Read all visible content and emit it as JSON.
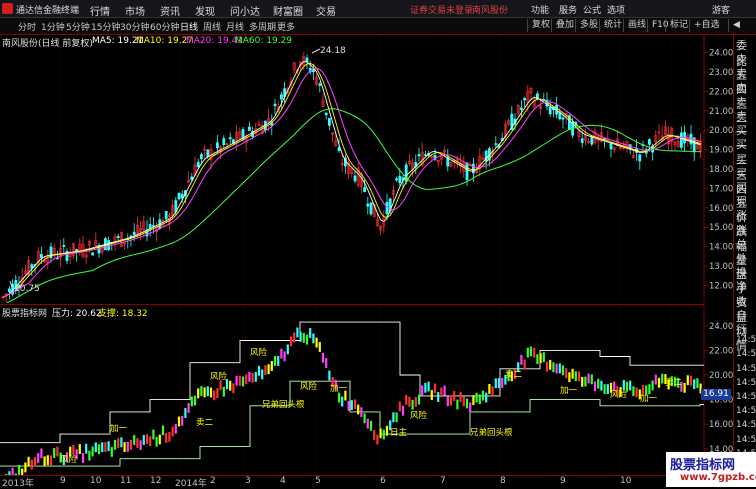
{
  "titlebar": {
    "app_name": "通达信金融终端",
    "menus": [
      "行情",
      "市场",
      "资讯",
      "发现",
      "问小达",
      "财富圈",
      "交易"
    ],
    "notice": "证券交易未登录",
    "stock_name": "南风股份",
    "right_menus": [
      "功能",
      "服务",
      "公式",
      "选项"
    ],
    "guest": "游客"
  },
  "periodbar": {
    "periods": [
      "分时",
      "1分钟",
      "5分钟",
      "15分钟",
      "30分钟",
      "60分钟",
      "日线",
      "周线",
      "月线",
      "多周期",
      "更多"
    ],
    "active_period": "日线",
    "tools": [
      "复权",
      "叠加",
      "多股",
      "统计",
      "画线",
      "F10",
      "标记",
      "+自选",
      "◀"
    ]
  },
  "main": {
    "title": "南风股份(日线 前复权)",
    "ma_legend": [
      {
        "label": "MA5: 19.21",
        "color": "#ffffff"
      },
      {
        "label": "MA10: 19.27",
        "color": "#ffff00"
      },
      {
        "label": "MA20: 19.41",
        "color": "#ff40ff"
      },
      {
        "label": "MA60: 19.29",
        "color": "#40ff40"
      }
    ],
    "high_label": "24.18",
    "low_label": "10.75",
    "axis_ticks": [
      "24.00",
      "23.00",
      "22.00",
      "21.00",
      "20.00",
      "19.00",
      "18.00",
      "17.00",
      "16.00",
      "15.00",
      "14.00",
      "13.00",
      "12.00"
    ]
  },
  "sub": {
    "title": "股票指标网",
    "legend": [
      {
        "label": "压力: 20.62",
        "color": "#ffffff"
      },
      {
        "label": "支撑: 18.32",
        "color": "#ffff00"
      }
    ],
    "axis_ticks": [
      "24.00",
      "22.00",
      "20.00",
      "18.00",
      "16.00",
      "14.00"
    ],
    "current_price": "16.91",
    "annotations": [
      "风险",
      "风险",
      "风险",
      "风险",
      "风险",
      "风险",
      "兄弟回头根",
      "兄弟回头根",
      "日主",
      "加一",
      "加一",
      "加一",
      "加一",
      "卖二",
      "卖二",
      "卖二"
    ]
  },
  "rightpanel": {
    "labels": [
      "委比",
      "卖五",
      "卖四",
      "卖三",
      "卖二",
      "卖一",
      "买一",
      "买二",
      "买三",
      "买四",
      "买五",
      "现价",
      "涨跌",
      "涨幅",
      "总量",
      "外盘",
      "换手",
      "净资",
      "收益",
      "自动",
      "行情",
      "14:56",
      "14:56",
      "14:56",
      "14:56",
      "14:56",
      "14:56",
      "14:56",
      "14:56",
      "14:56",
      "14:56"
    ]
  },
  "datebar": {
    "ticks": [
      "2013年",
      "9",
      "10",
      "11",
      "12",
      "2014年",
      "2",
      "3",
      "4",
      "5",
      "6",
      "7",
      "8",
      "9",
      "10",
      "11"
    ]
  },
  "watermark": {
    "line1": "股票指标网",
    "line2": "www.7gpzb.com"
  },
  "colors": {
    "up": "#ff3030",
    "down": "#30ffff",
    "ma5": "#ffffff",
    "ma10": "#ffff00",
    "ma20": "#ff40ff",
    "ma60": "#40ff40",
    "frame": "#8b0000"
  }
}
